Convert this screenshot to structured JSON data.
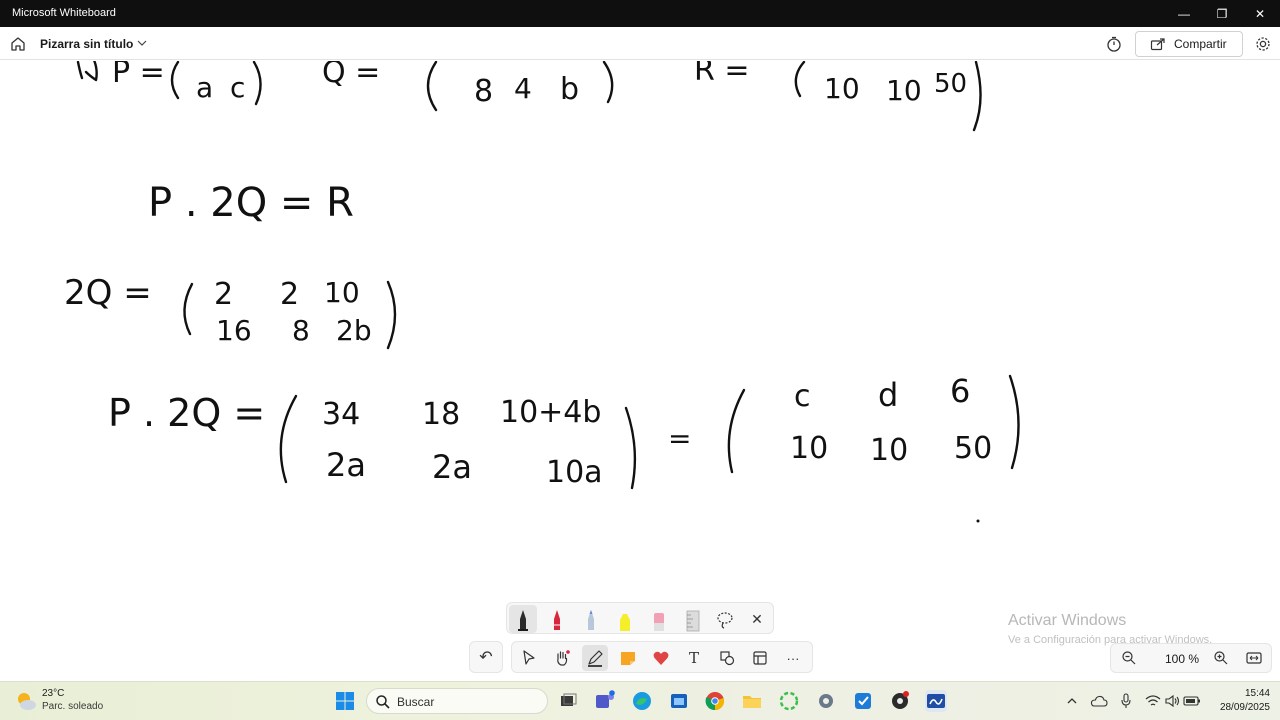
{
  "window": {
    "app_title": "Microsoft Whiteboard",
    "minimize_symbol": "—",
    "restore_symbol": "❐",
    "close_symbol": "✕"
  },
  "toolbar": {
    "board_title": "Pizarra sin título",
    "share_label": "Compartir"
  },
  "canvas": {
    "ink_color": "#111111",
    "lines": [
      {
        "id": "matrices-row",
        "text": "P = ( a c )   Q = ( 8 4 b )   R = ( 10 10 50 )"
      },
      {
        "id": "equation",
        "text": "P . 2Q = R"
      },
      {
        "id": "twoq",
        "lhs": "2Q =",
        "row1": [
          "2",
          "2",
          "10"
        ],
        "row2": [
          "16",
          "8",
          "2b"
        ]
      },
      {
        "id": "product",
        "lhs": "P . 2Q =",
        "row1": [
          "34",
          "18",
          "10+4b"
        ],
        "row2": [
          "2a",
          "2a",
          "10a"
        ],
        "eq": "=",
        "rhs_row1": [
          "c",
          "d",
          "6"
        ],
        "rhs_row2": [
          "10",
          "10",
          "50"
        ]
      }
    ],
    "partial_top": {
      "p_label": "P =",
      "p_row2": [
        "a",
        "c"
      ],
      "q_label": "Q =",
      "q_row2": [
        "8",
        "4",
        "b"
      ],
      "r_label": "R =",
      "r_row2": [
        "10",
        "10",
        "50"
      ]
    }
  },
  "pen_tray": {
    "pens": [
      {
        "name": "black-pen",
        "color": "#1b1b1b",
        "selected": true
      },
      {
        "name": "red-pen",
        "color": "#d7263d",
        "selected": false
      },
      {
        "name": "blue-pen",
        "color": "#5b8fd6",
        "selected": false
      },
      {
        "name": "highlighter",
        "color": "#f4ef2a",
        "selected": false
      },
      {
        "name": "eraser",
        "color": "#f2a0b4",
        "selected": false
      },
      {
        "name": "ruler",
        "color": "#c9c9c9",
        "selected": false
      }
    ],
    "close_symbol": "✕"
  },
  "tools": {
    "text_tool_glyph": "T",
    "more_glyph": "···",
    "undo_glyph": "↶"
  },
  "zoom": {
    "level": "100 %"
  },
  "watermark": {
    "title": "Activar Windows",
    "subtitle": "Ve a Configuración para activar Windows."
  },
  "taskbar": {
    "weather_temp": "23°C",
    "weather_cond": "Parc. soleado",
    "search_label": "Buscar",
    "time": "15:44",
    "date": "28/09/2025"
  }
}
